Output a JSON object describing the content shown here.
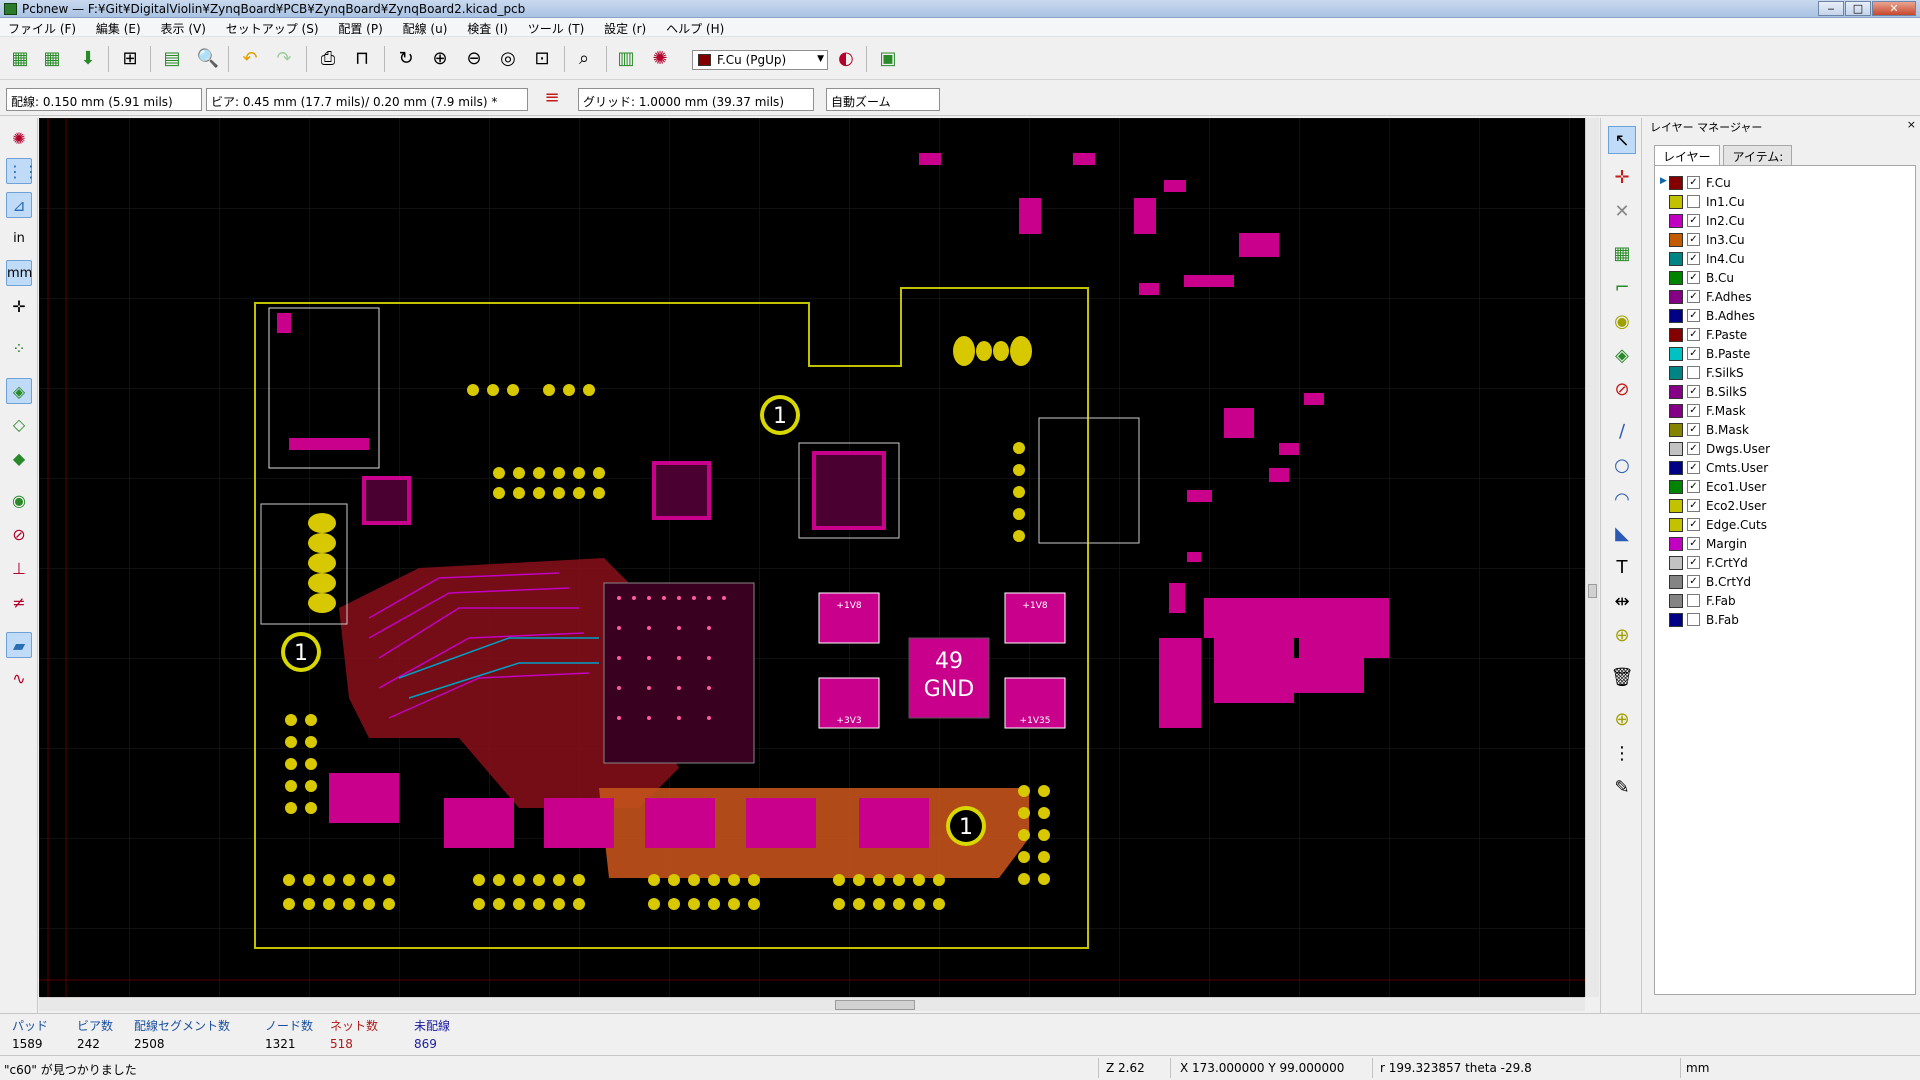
{
  "window": {
    "title": "Pcbnew — F:¥Git¥DigitalViolin¥ZynqBoard¥PCB¥ZynqBoard¥ZynqBoard2.kicad_pcb",
    "minimize": "‒",
    "maximize": "□",
    "close": "✕"
  },
  "menu": [
    "ファイル (F)",
    "編集 (E)",
    "表示 (V)",
    "セットアップ (S)",
    "配置 (P)",
    "配線 (u)",
    "検査 (I)",
    "ツール (T)",
    "設定 (r)",
    "ヘルプ (H)"
  ],
  "toolbar": {
    "active_layer": "F.Cu (PgUp)",
    "active_layer_color": "#840000"
  },
  "toolbar2": {
    "track_width": "配線: 0.150 mm (5.91 mils)",
    "via_size": "ビア: 0.45 mm (17.7 mils)/ 0.20 mm (7.9 mils) *",
    "grid": "グリッド: 1.0000 mm (39.37 mils)",
    "zoom": "自動ズーム"
  },
  "left_toolbar": {
    "in_label": "in",
    "mm_label": "mm"
  },
  "canvas": {
    "background": "#000000",
    "board_outline_color": "#c2c200",
    "pad_color": "#c8008c",
    "center_label_num": "49",
    "center_label_net": "GND",
    "mounting_hole_label": "1",
    "net_labels": [
      "+1V8",
      "+1V8",
      "+3V3",
      "+1V35"
    ]
  },
  "layer_manager": {
    "title": "レイヤー マネージャー",
    "close": "×",
    "tabs": [
      "レイヤー",
      "アイテム:"
    ],
    "layers": [
      {
        "name": "F.Cu",
        "color": "#840000",
        "checked": true,
        "active": true
      },
      {
        "name": "In1.Cu",
        "color": "#c2c200",
        "checked": false
      },
      {
        "name": "In2.Cu",
        "color": "#c200c2",
        "checked": true
      },
      {
        "name": "In3.Cu",
        "color": "#c25a00",
        "checked": true
      },
      {
        "name": "In4.Cu",
        "color": "#008484",
        "checked": true
      },
      {
        "name": "B.Cu",
        "color": "#008400",
        "checked": true
      },
      {
        "name": "F.Adhes",
        "color": "#840084",
        "checked": true
      },
      {
        "name": "B.Adhes",
        "color": "#000084",
        "checked": true
      },
      {
        "name": "F.Paste",
        "color": "#840000",
        "checked": true
      },
      {
        "name": "B.Paste",
        "color": "#00c2c2",
        "checked": true
      },
      {
        "name": "F.SilkS",
        "color": "#008484",
        "checked": false
      },
      {
        "name": "B.SilkS",
        "color": "#840084",
        "checked": true
      },
      {
        "name": "F.Mask",
        "color": "#840084",
        "checked": true
      },
      {
        "name": "B.Mask",
        "color": "#848400",
        "checked": true
      },
      {
        "name": "Dwgs.User",
        "color": "#c2c2c2",
        "checked": true
      },
      {
        "name": "Cmts.User",
        "color": "#000084",
        "checked": true
      },
      {
        "name": "Eco1.User",
        "color": "#008400",
        "checked": true
      },
      {
        "name": "Eco2.User",
        "color": "#c2c200",
        "checked": true
      },
      {
        "name": "Edge.Cuts",
        "color": "#c2c200",
        "checked": true
      },
      {
        "name": "Margin",
        "color": "#c200c2",
        "checked": true
      },
      {
        "name": "F.CrtYd",
        "color": "#c2c2c2",
        "checked": true
      },
      {
        "name": "B.CrtYd",
        "color": "#848484",
        "checked": true
      },
      {
        "name": "F.Fab",
        "color": "#848484",
        "checked": false
      },
      {
        "name": "B.Fab",
        "color": "#000084",
        "checked": false
      }
    ]
  },
  "stats": {
    "pads_label": "パッド",
    "pads": "1589",
    "vias_label": "ビア数",
    "vias": "242",
    "segments_label": "配線セグメント数",
    "segments": "2508",
    "nodes_label": "ノード数",
    "nodes": "1321",
    "nets_label": "ネット数",
    "nets": "518",
    "unrouted_label": "未配線",
    "unrouted": "869"
  },
  "statusline": {
    "message": "\"c60\" が見つかりました",
    "zoom": "Z 2.62",
    "xy": "X 173.000000  Y 99.000000",
    "polar": "r 199.323857  theta -29.8",
    "units": "mm"
  }
}
